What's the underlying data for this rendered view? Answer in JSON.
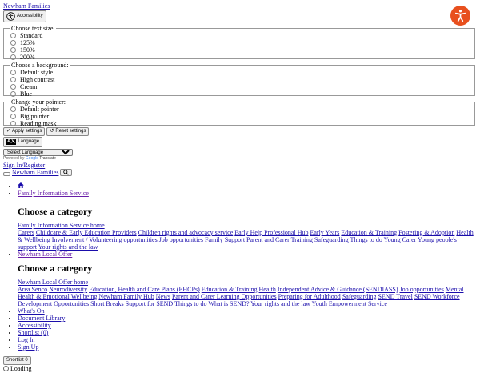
{
  "site_link": "Newham Families",
  "accessibility_button": "Accessibility",
  "text_size": {
    "legend": "Choose text size:",
    "options": [
      "Standard",
      "125%",
      "150%",
      "200%"
    ]
  },
  "background": {
    "legend": "Choose a background:",
    "options": [
      "Default style",
      "High contrast",
      "Cream",
      "Blue"
    ]
  },
  "pointer": {
    "legend": "Change your pointer:",
    "options": [
      "Default pointer",
      "Big pointer",
      "Reading mask"
    ]
  },
  "apply_button": "Apply settings",
  "reset_button": "Reset settings",
  "language_button": "Language",
  "language_icon": "A文",
  "select_language": "Select Language",
  "powered_by": "Powered by",
  "google": "Google",
  "translate": "Translate",
  "sign_in": "Sign In/Register",
  "nav_site": "Newham Families",
  "nav": {
    "fis": "Family Information Service",
    "heading": "Choose a category",
    "fis_home": "Family Information Service home",
    "fis_links": [
      "Carers",
      "Childcare & Early Education Providers",
      "Children rights and advocacy service",
      "Early Help Professional Hub",
      "Early Years",
      "Education & Training",
      "Fostering & Adoption",
      "Health & Wellbeing",
      "Involvement / Volunteering opportunities",
      "Job opportunities",
      "Family Support",
      "Parent and Carer Training",
      "Safeguarding",
      "Things to do",
      "Young Carer",
      "Young people's support",
      "Your rights and the law"
    ],
    "nlo": "Newham Local Offer",
    "nlo_home": "Newham Local Offer home",
    "nlo_links": [
      "Area Senco",
      "Neurodiversity",
      "Education, Health and Care Plans (EHCPs)",
      "Education & Training",
      "Health",
      "Independent Advice & Guidance (SENDIASS)",
      "Job opportunities",
      "Mental Health & Emotional Wellbeing",
      "Newham Family Hub",
      "News",
      "Parent and Carer Learning Opportunities",
      "Preparing for Adulthood",
      "Safeguarding",
      "SEND Travel",
      "SEND Workforce Development Opportunities",
      "Short Breaks",
      "Support for SEND",
      "Things to do",
      "What is SEND?",
      "Your rights and the law",
      "Youth Empowerment Service"
    ],
    "more": [
      "What's On",
      "Document Library",
      "Accessibility",
      "Shortlist (0)",
      "Log In",
      "Sign Up"
    ]
  },
  "shortlist_button": "Shortlist 0",
  "loading": "Loading",
  "colors": {
    "fab": "#e8501e",
    "link": "#1a0dab"
  }
}
